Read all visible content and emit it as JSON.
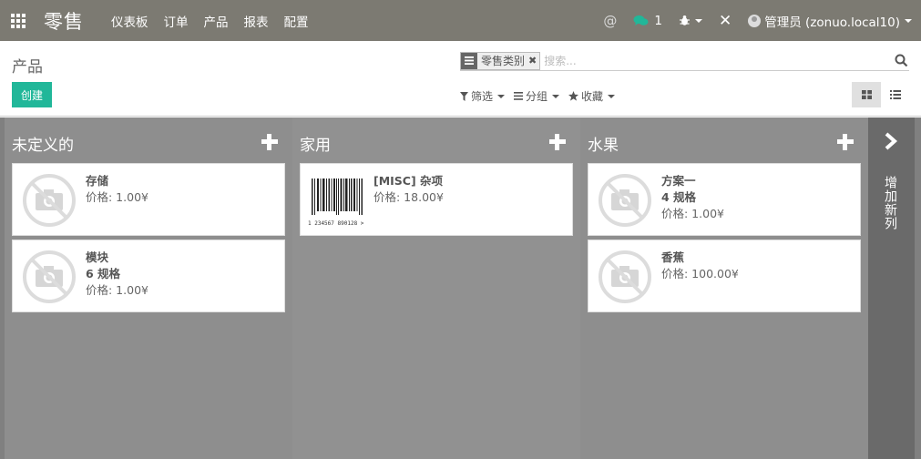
{
  "app": {
    "title": "零售"
  },
  "nav": {
    "items": [
      "仪表板",
      "订单",
      "产品",
      "报表",
      "配置"
    ]
  },
  "topright": {
    "at": "@",
    "message_count": "1",
    "user": "管理员 (zonuo.local10)"
  },
  "breadcrumb": "产品",
  "create_label": "创建",
  "search": {
    "facet_label": "零售类别",
    "placeholder": "搜索..."
  },
  "filters": {
    "filter": "筛选",
    "group": "分组",
    "favorite": "收藏"
  },
  "columns": [
    {
      "title": "未定义的",
      "cards": [
        {
          "name": "存储",
          "variants": "",
          "price": "价格: 1.00¥",
          "image": "no-image"
        },
        {
          "name": "模块",
          "variants": "6 规格",
          "price": "价格: 1.00¥",
          "image": "no-image"
        }
      ]
    },
    {
      "title": "家用",
      "cards": [
        {
          "name": "[MISC] 杂项",
          "variants": "",
          "price": "价格: 18.00¥",
          "image": "barcode",
          "barcode_text": "1 234567 890128 >"
        }
      ]
    },
    {
      "title": "水果",
      "cards": [
        {
          "name": "方案一",
          "variants": "4 规格",
          "price": "价格: 1.00¥",
          "image": "no-image"
        },
        {
          "name": "香蕉",
          "variants": "",
          "price": "价格: 100.00¥",
          "image": "no-image"
        }
      ]
    }
  ],
  "add_column_label": "增加新列",
  "colors": {
    "navbar": "#7c7a72",
    "primary": "#21b799",
    "kanban_bg": "#8e8e8e",
    "badge": "#21b799"
  }
}
